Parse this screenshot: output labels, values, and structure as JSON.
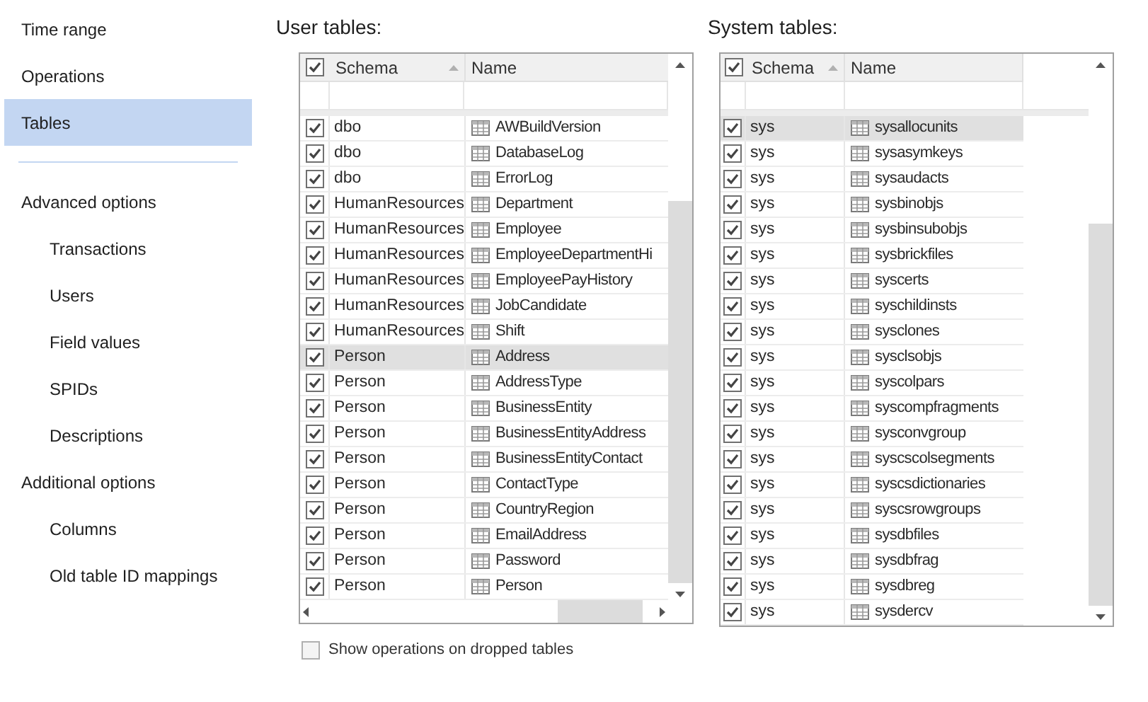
{
  "sidebar": {
    "top_items": [
      {
        "label": "Time range",
        "selected": false
      },
      {
        "label": "Operations",
        "selected": false
      },
      {
        "label": "Tables",
        "selected": true
      }
    ],
    "option_groups": [
      {
        "label": "Advanced options",
        "children": [
          {
            "label": "Transactions"
          },
          {
            "label": "Users"
          },
          {
            "label": "Field values"
          },
          {
            "label": "SPIDs"
          },
          {
            "label": "Descriptions"
          }
        ]
      },
      {
        "label": "Additional options",
        "children": [
          {
            "label": "Columns"
          },
          {
            "label": "Old table ID mappings"
          }
        ]
      }
    ]
  },
  "user_tables": {
    "title": "User tables:",
    "all_checked": true,
    "columns": [
      {
        "label": "Schema",
        "sorted": true
      },
      {
        "label": "Name",
        "sorted": false
      }
    ],
    "horizontal_scroll": true,
    "rows": [
      {
        "schema": "dbo",
        "name": "AWBuildVersion",
        "checked": true,
        "selected": false
      },
      {
        "schema": "dbo",
        "name": "DatabaseLog",
        "checked": true,
        "selected": false
      },
      {
        "schema": "dbo",
        "name": "ErrorLog",
        "checked": true,
        "selected": false
      },
      {
        "schema": "HumanResources",
        "name": "Department",
        "checked": true,
        "selected": false
      },
      {
        "schema": "HumanResources",
        "name": "Employee",
        "checked": true,
        "selected": false
      },
      {
        "schema": "HumanResources",
        "name": "EmployeeDepartmentHi",
        "checked": true,
        "selected": false
      },
      {
        "schema": "HumanResources",
        "name": "EmployeePayHistory",
        "checked": true,
        "selected": false
      },
      {
        "schema": "HumanResources",
        "name": "JobCandidate",
        "checked": true,
        "selected": false
      },
      {
        "schema": "HumanResources",
        "name": "Shift",
        "checked": true,
        "selected": false
      },
      {
        "schema": "Person",
        "name": "Address",
        "checked": true,
        "selected": true
      },
      {
        "schema": "Person",
        "name": "AddressType",
        "checked": true,
        "selected": false
      },
      {
        "schema": "Person",
        "name": "BusinessEntity",
        "checked": true,
        "selected": false
      },
      {
        "schema": "Person",
        "name": "BusinessEntityAddress",
        "checked": true,
        "selected": false
      },
      {
        "schema": "Person",
        "name": "BusinessEntityContact",
        "checked": true,
        "selected": false
      },
      {
        "schema": "Person",
        "name": "ContactType",
        "checked": true,
        "selected": false
      },
      {
        "schema": "Person",
        "name": "CountryRegion",
        "checked": true,
        "selected": false
      },
      {
        "schema": "Person",
        "name": "EmailAddress",
        "checked": true,
        "selected": false
      },
      {
        "schema": "Person",
        "name": "Password",
        "checked": true,
        "selected": false
      },
      {
        "schema": "Person",
        "name": "Person",
        "checked": true,
        "selected": false
      }
    ]
  },
  "system_tables": {
    "title": "System tables:",
    "all_checked": true,
    "columns": [
      {
        "label": "Schema",
        "sorted": true
      },
      {
        "label": "Name",
        "sorted": false
      }
    ],
    "horizontal_scroll": false,
    "rows": [
      {
        "schema": "sys",
        "name": "sysallocunits",
        "checked": true,
        "selected": true
      },
      {
        "schema": "sys",
        "name": "sysasymkeys",
        "checked": true,
        "selected": false
      },
      {
        "schema": "sys",
        "name": "sysaudacts",
        "checked": true,
        "selected": false
      },
      {
        "schema": "sys",
        "name": "sysbinobjs",
        "checked": true,
        "selected": false
      },
      {
        "schema": "sys",
        "name": "sysbinsubobjs",
        "checked": true,
        "selected": false
      },
      {
        "schema": "sys",
        "name": "sysbrickfiles",
        "checked": true,
        "selected": false
      },
      {
        "schema": "sys",
        "name": "syscerts",
        "checked": true,
        "selected": false
      },
      {
        "schema": "sys",
        "name": "syschildinsts",
        "checked": true,
        "selected": false
      },
      {
        "schema": "sys",
        "name": "sysclones",
        "checked": true,
        "selected": false
      },
      {
        "schema": "sys",
        "name": "sysclsobjs",
        "checked": true,
        "selected": false
      },
      {
        "schema": "sys",
        "name": "syscolpars",
        "checked": true,
        "selected": false
      },
      {
        "schema": "sys",
        "name": "syscompfragments",
        "checked": true,
        "selected": false
      },
      {
        "schema": "sys",
        "name": "sysconvgroup",
        "checked": true,
        "selected": false
      },
      {
        "schema": "sys",
        "name": "syscscolsegments",
        "checked": true,
        "selected": false
      },
      {
        "schema": "sys",
        "name": "syscsdictionaries",
        "checked": true,
        "selected": false
      },
      {
        "schema": "sys",
        "name": "syscsrowgroups",
        "checked": true,
        "selected": false
      },
      {
        "schema": "sys",
        "name": "sysdbfiles",
        "checked": true,
        "selected": false
      },
      {
        "schema": "sys",
        "name": "sysdbfrag",
        "checked": true,
        "selected": false
      },
      {
        "schema": "sys",
        "name": "sysdbreg",
        "checked": true,
        "selected": false
      },
      {
        "schema": "sys",
        "name": "sysdercv",
        "checked": true,
        "selected": false
      }
    ]
  },
  "dropped_tables_option": {
    "label": "Show operations on dropped tables",
    "checked": false
  }
}
